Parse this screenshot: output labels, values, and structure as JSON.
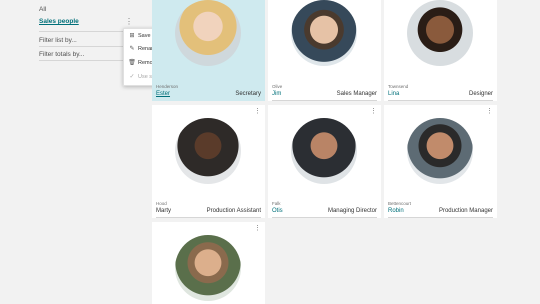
{
  "left_nav": {
    "all": "All",
    "sales_people": "Sales people",
    "filter_list_by": "Filter list by...",
    "filter_totals_by": "Filter totals by...",
    "kebab": "⋮"
  },
  "context_menu": {
    "items": [
      {
        "label": "Save as...",
        "icon": "⊞"
      },
      {
        "label": "Rename...",
        "icon": "✎"
      },
      {
        "label": "Remove",
        "icon": "🗑"
      },
      {
        "label": "Use shared layout",
        "icon": "✓"
      }
    ]
  },
  "cards": [
    {
      "last": "Henderson",
      "first": "Ester",
      "title": "Secretary"
    },
    {
      "last": "Olive",
      "first": "Jim",
      "title": "Sales Manager"
    },
    {
      "last": "Townsend",
      "first": "Lina",
      "title": "Designer"
    },
    {
      "last": "Hood",
      "first": "Marty",
      "title": "Production Assistant"
    },
    {
      "last": "Falk",
      "first": "Otis",
      "title": "Managing Director"
    },
    {
      "last": "Bettencourt",
      "first": "Robin",
      "title": "Production Manager"
    },
    {
      "last": "",
      "first": "",
      "title": ""
    }
  ],
  "card_more": "⋮",
  "colors": {
    "accent": "#00707a",
    "selected_card": "#cfeaef"
  }
}
